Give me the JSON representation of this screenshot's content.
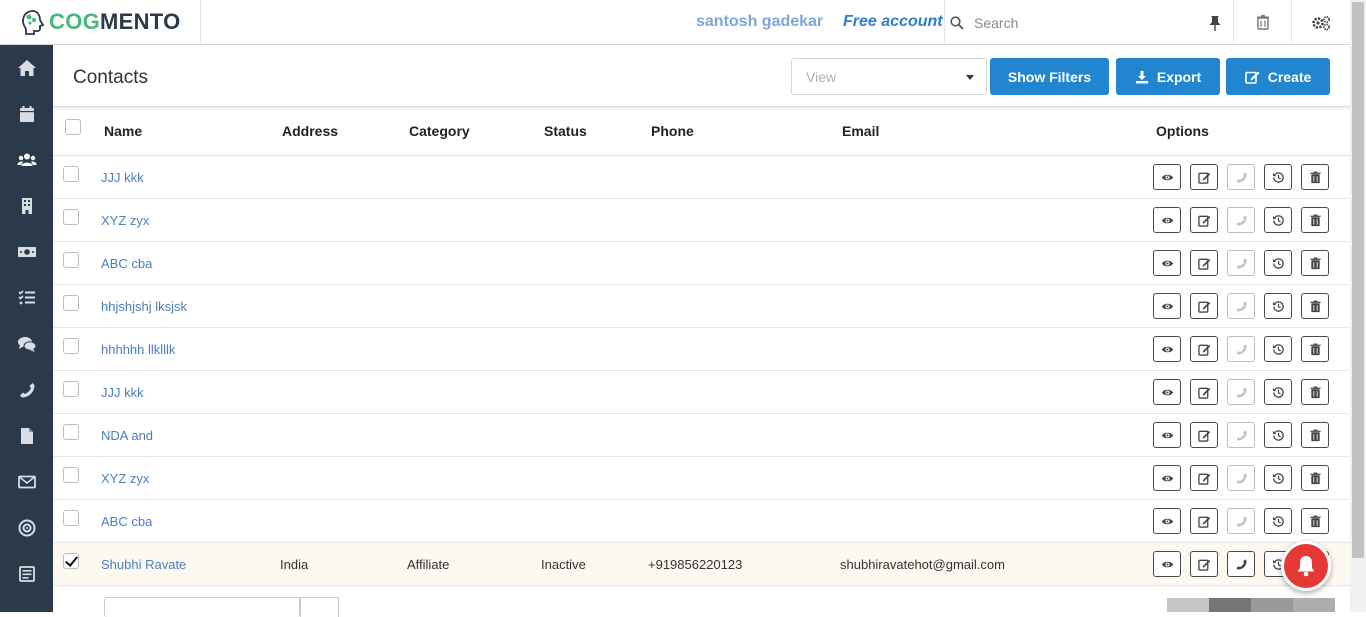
{
  "header": {
    "logo_part1": "COG",
    "logo_part2": "MENTO",
    "user_name": "santosh gadekar",
    "account_type": "Free account",
    "search_placeholder": "Search"
  },
  "sidebar": {
    "items": [
      {
        "icon": "home-icon"
      },
      {
        "icon": "calendar-icon"
      },
      {
        "icon": "users-icon"
      },
      {
        "icon": "building-icon"
      },
      {
        "icon": "money-icon"
      },
      {
        "icon": "tasks-icon"
      },
      {
        "icon": "comments-icon"
      },
      {
        "icon": "phone-icon"
      },
      {
        "icon": "file-icon"
      },
      {
        "icon": "envelope-icon"
      },
      {
        "icon": "target-icon"
      },
      {
        "icon": "campaign-icon"
      }
    ]
  },
  "page": {
    "title": "Contacts",
    "view_placeholder": "View",
    "show_filters_label": "Show Filters",
    "export_label": "Export",
    "create_label": "Create"
  },
  "table": {
    "columns": [
      "Name",
      "Address",
      "Category",
      "Status",
      "Phone",
      "Email",
      "Options"
    ],
    "rows": [
      {
        "name": "JJJ kkk",
        "address": "",
        "category": "",
        "status": "",
        "phone": "",
        "email": "",
        "checked": false
      },
      {
        "name": "XYZ zyx",
        "address": "",
        "category": "",
        "status": "",
        "phone": "",
        "email": "",
        "checked": false
      },
      {
        "name": "ABC cba",
        "address": "",
        "category": "",
        "status": "",
        "phone": "",
        "email": "",
        "checked": false
      },
      {
        "name": "hhjshjshj lksjsk",
        "address": "",
        "category": "",
        "status": "",
        "phone": "",
        "email": "",
        "checked": false
      },
      {
        "name": "hhhhhh llklllk",
        "address": "",
        "category": "",
        "status": "",
        "phone": "",
        "email": "",
        "checked": false
      },
      {
        "name": "JJJ kkk",
        "address": "",
        "category": "",
        "status": "",
        "phone": "",
        "email": "",
        "checked": false
      },
      {
        "name": "NDA and",
        "address": "",
        "category": "",
        "status": "",
        "phone": "",
        "email": "",
        "checked": false
      },
      {
        "name": "XYZ zyx",
        "address": "",
        "category": "",
        "status": "",
        "phone": "",
        "email": "",
        "checked": false
      },
      {
        "name": "ABC cba",
        "address": "",
        "category": "",
        "status": "",
        "phone": "",
        "email": "",
        "checked": false
      },
      {
        "name": "Shubhi Ravate",
        "address": "India",
        "category": "Affiliate",
        "status": "Inactive",
        "phone": "+919856220123",
        "email": "shubhiravatehot@gmail.com",
        "checked": true
      }
    ]
  },
  "colors": {
    "sidebar_bg": "#2b3a4a",
    "primary_button": "#2185d0",
    "link": "#4a7fbf",
    "notification": "#e53935"
  }
}
